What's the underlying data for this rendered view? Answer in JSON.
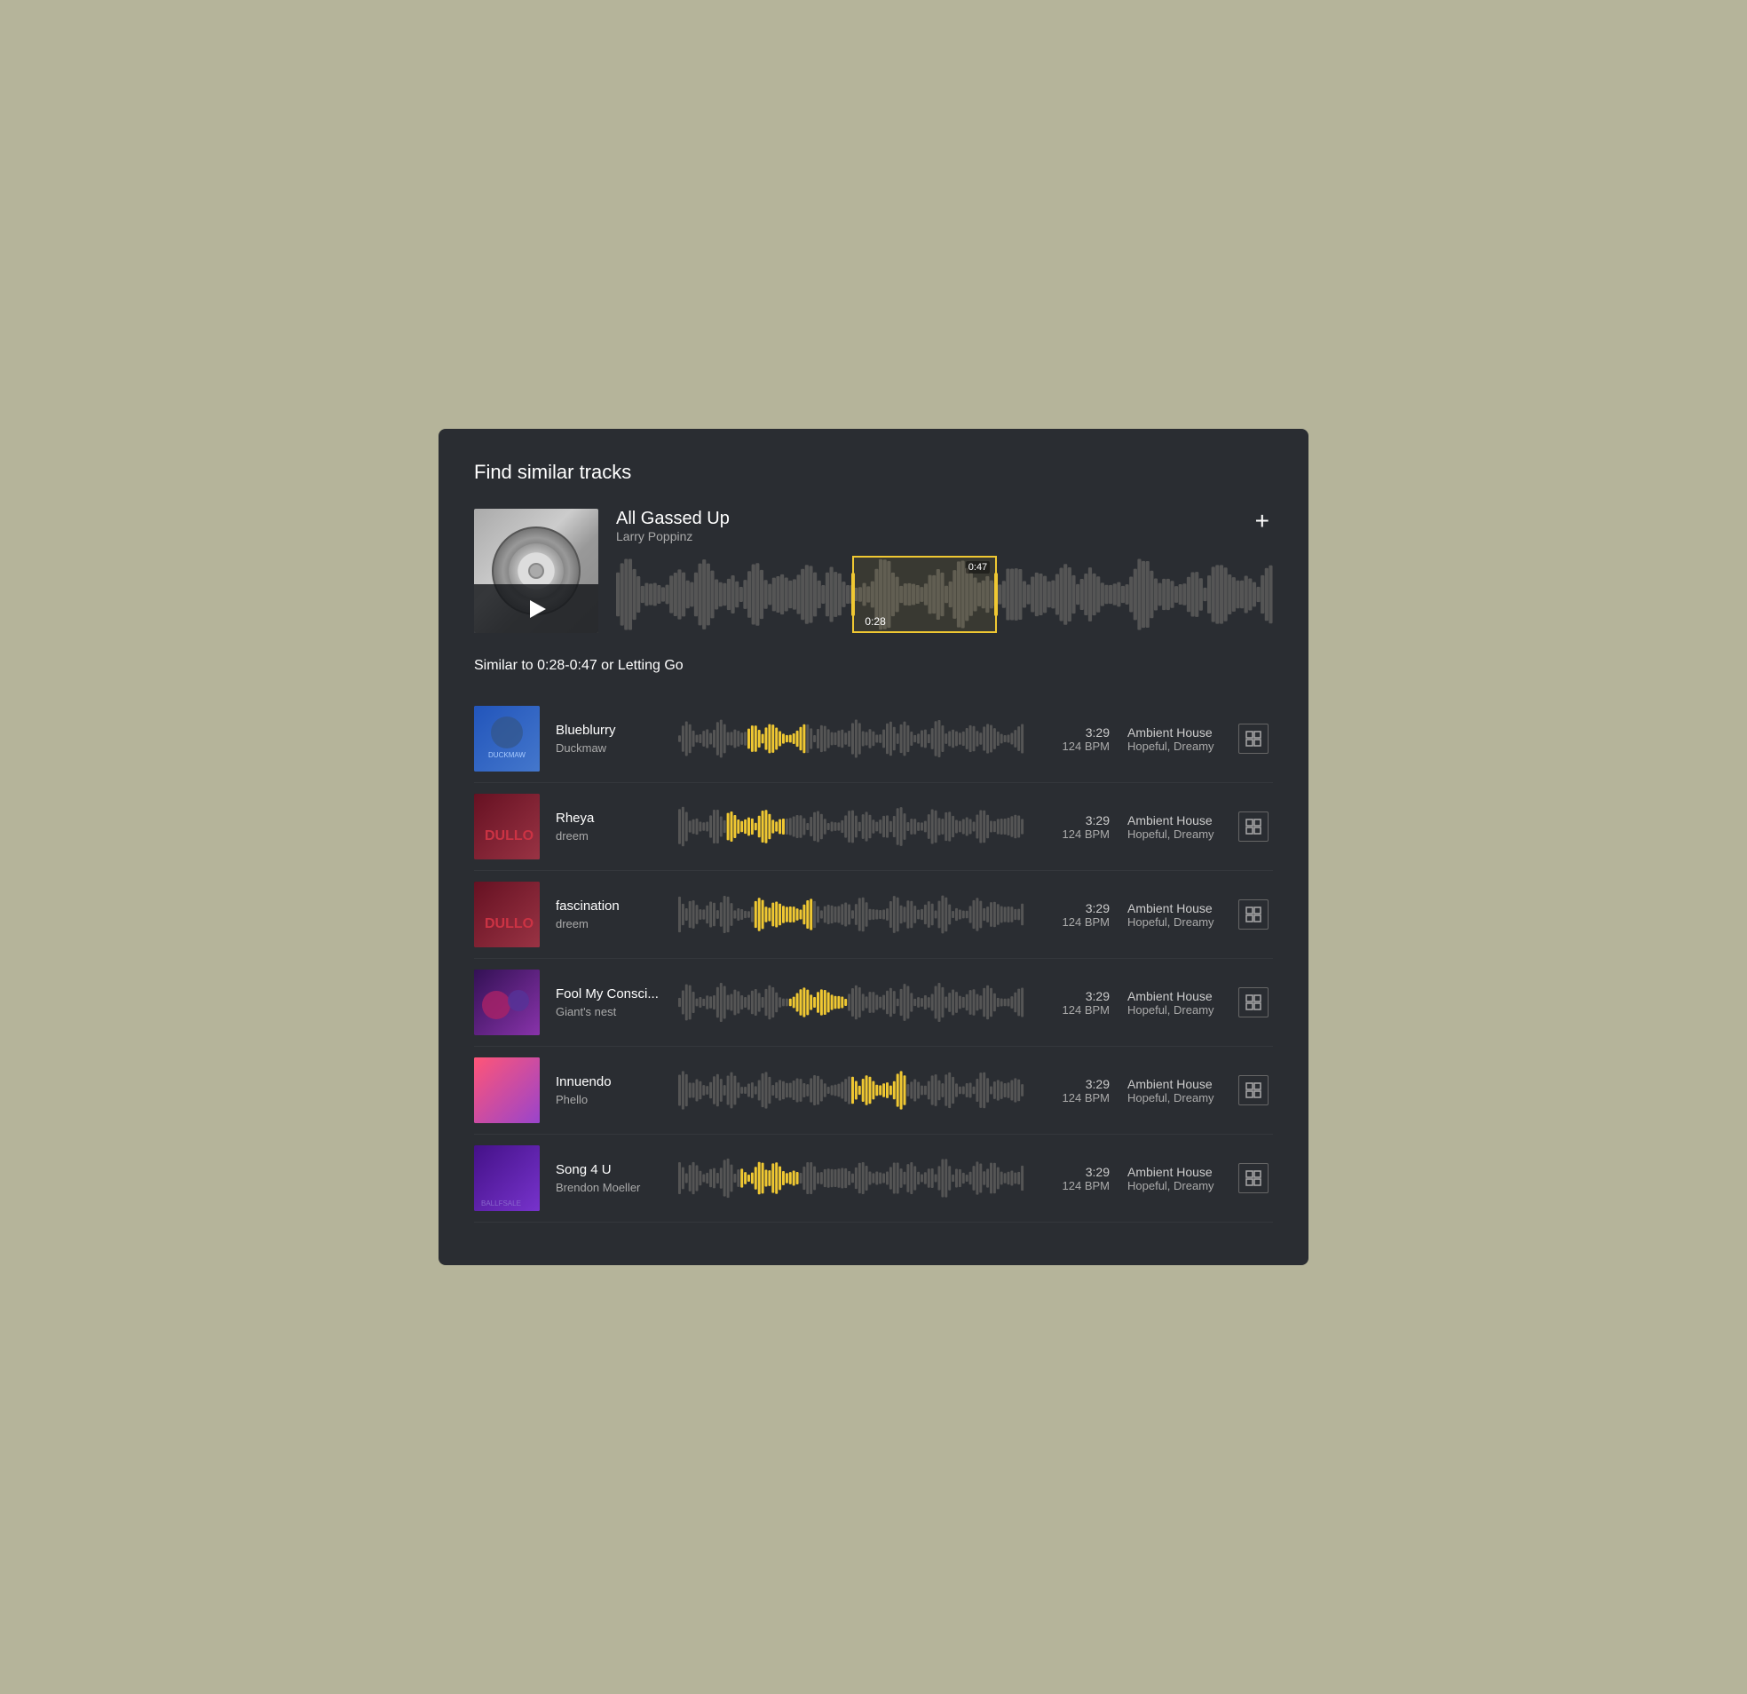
{
  "panel": {
    "title": "Find similar tracks"
  },
  "source_track": {
    "title": "All Gassed Up",
    "artist": "Larry Poppinz",
    "selection_start": "0:28",
    "selection_end": "0:47",
    "plus_label": "+"
  },
  "similar_label": "Similar to 0:28-0:47 or Letting Go",
  "tracks": [
    {
      "name": "Blueblurry",
      "artist": "Duckmaw",
      "duration": "3:29",
      "bpm": "124 BPM",
      "genre": "Ambient House",
      "mood": "Hopeful, Dreamy",
      "art_class": "art-blueblurry",
      "highlight_pos": 0.28
    },
    {
      "name": "Rheya",
      "artist": "dreem",
      "duration": "3:29",
      "bpm": "124 BPM",
      "genre": "Ambient House",
      "mood": "Hopeful, Dreamy",
      "art_class": "art-rheya",
      "highlight_pos": 0.22
    },
    {
      "name": "fascination",
      "artist": "dreem",
      "duration": "3:29",
      "bpm": "124 BPM",
      "genre": "Ambient House",
      "mood": "Hopeful, Dreamy",
      "art_class": "art-fascination",
      "highlight_pos": 0.3
    },
    {
      "name": "Fool My Consci...",
      "artist": "Giant's nest",
      "duration": "3:29",
      "bpm": "124 BPM",
      "genre": "Ambient House",
      "mood": "Hopeful, Dreamy",
      "art_class": "art-fool",
      "highlight_pos": 0.4
    },
    {
      "name": "Innuendo",
      "artist": "Phello",
      "duration": "3:29",
      "bpm": "124 BPM",
      "genre": "Ambient House",
      "mood": "Hopeful, Dreamy",
      "art_class": "art-innuendo",
      "highlight_pos": 0.58
    },
    {
      "name": "Song 4 U",
      "artist": "Brendon Moeller",
      "duration": "3:29",
      "bpm": "124 BPM",
      "genre": "Ambient House",
      "mood": "Hopeful, Dreamy",
      "art_class": "art-song4u",
      "highlight_pos": 0.26
    }
  ],
  "action_icon_label": "⊞"
}
